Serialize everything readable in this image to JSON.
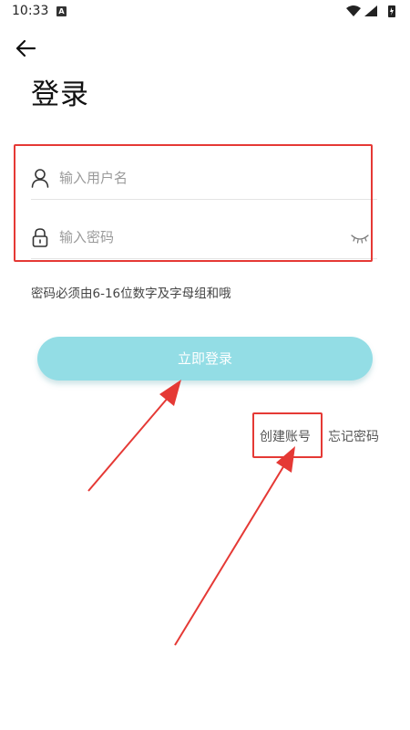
{
  "status_bar": {
    "time": "10:33",
    "notification_icon": "a-letter-icon",
    "icons": [
      "wifi-icon",
      "signal-icon",
      "battery-charging-icon"
    ]
  },
  "header": {
    "back_icon": "arrow-left-icon",
    "title": "登录"
  },
  "form": {
    "username": {
      "icon": "user-icon",
      "placeholder": "输入用户名",
      "value": ""
    },
    "password": {
      "icon": "lock-icon",
      "placeholder": "输入密码",
      "value": "",
      "toggle_icon": "eye-closed-icon"
    },
    "hint": "密码必须由6-16位数字及字母组和哦"
  },
  "actions": {
    "login_label": "立即登录",
    "create_account_label": "创建账号",
    "forgot_password_label": "忘记密码"
  },
  "colors": {
    "primary_button": "#93dde5",
    "annotation": "#e53935"
  }
}
